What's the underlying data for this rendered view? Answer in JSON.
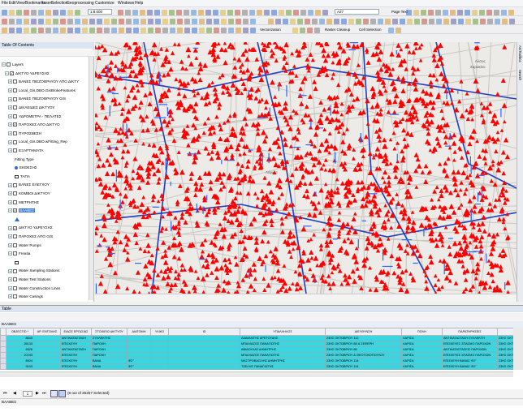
{
  "menu": [
    "File",
    "Edit",
    "View",
    "Bookmarks",
    "Insert",
    "Selection",
    "Geoprocessing",
    "Customize",
    "Windows",
    "Help"
  ],
  "toolbar": {
    "scale": "1:8.000",
    "combo2": "A27",
    "page_text": "Page Text",
    "vectorization": "Vectorization",
    "raster_cleanup": "Raster Cleanup",
    "cell_selection": "Cell Selection"
  },
  "toc": {
    "title": "Table Of Contents",
    "layers": [
      {
        "label": "Layers",
        "indent": 0,
        "expand": "−",
        "check": false,
        "icon": "group"
      },
      {
        "label": "ΔΙΚΤΥΟ ΥΔΡΕΥΣΗΣ",
        "indent": 1,
        "expand": "−",
        "check": true
      },
      {
        "label": "ΒΑΝΕΣ ΠΙΕΖΟΘΡΑΥΟΥ ΑΠΟ ΔΙΚΤΥ",
        "indent": 2,
        "expand": "+",
        "check": false
      },
      {
        "label": "Local_Gis.DBO.GisBrokeFeatures",
        "indent": 2,
        "expand": "+",
        "check": false
      },
      {
        "label": "ΒΑΝΕΣ ΠΙΕΖΟΘΡΑΥΟΥ GIS",
        "indent": 2,
        "expand": "+",
        "check": false
      },
      {
        "label": "ΔΙΚΛΕΙΔΕΣ ΔΙΚΤΥΟΥ",
        "indent": 2,
        "expand": "+",
        "check": false
      },
      {
        "label": "ΥΔΡΟΜΕΤΡΑ - ΠΕΛΑΤΕΣ",
        "indent": 2,
        "expand": "+",
        "check": false
      },
      {
        "label": "ΠΑΡΟΧΕΣ ΑΠΟ ΔΙΚΤΥΟ",
        "indent": 2,
        "expand": "+",
        "check": true
      },
      {
        "label": "ΠΥΡΟΣΒΕΣΗ",
        "indent": 2,
        "expand": "+",
        "check": false
      },
      {
        "label": "Local_Gis.DBO.wFitting_Rep",
        "indent": 2,
        "expand": "+",
        "check": false
      },
      {
        "label": "ΕΞΑΡΤΗΜΑΤΑ",
        "indent": 2,
        "expand": "−",
        "check": false
      },
      {
        "label": "Fitting Type",
        "indent": 4,
        "expand": "",
        "check": false,
        "plain": true
      },
      {
        "label": "ΕΚΘΕΣΗΣ",
        "indent": 4,
        "expand": "",
        "check": false,
        "plain": true,
        "sym": "dot"
      },
      {
        "label": "ΤΑΠΑ",
        "indent": 4,
        "expand": "",
        "check": false,
        "plain": true,
        "sym": "sq"
      },
      {
        "label": "ΒΑΝΕΣ ΕΛΕΓΧΟΥ",
        "indent": 2,
        "expand": "+",
        "check": false
      },
      {
        "label": "ΚΟΜΒΟΙ ΔΙΚΤΥΟΥ",
        "indent": 2,
        "expand": "+",
        "check": false
      },
      {
        "label": "ΜΕΤΡΗΤΗΣ",
        "indent": 2,
        "expand": "+",
        "check": false
      },
      {
        "label": "ΒΛΑΒΕΣ",
        "indent": 2,
        "expand": "−",
        "check": true,
        "selected": true
      },
      {
        "label": "",
        "indent": 4,
        "expand": "",
        "check": false,
        "plain": true,
        "sym": "tri"
      },
      {
        "label": "ΔΙΚΤΥΟ ΥΔΡΕΥΣΗΣ",
        "indent": 2,
        "expand": "+",
        "check": true
      },
      {
        "label": "ΠΑΡΟΧΕΣ ΑΠΟ GIS",
        "indent": 2,
        "expand": "+",
        "check": false
      },
      {
        "label": "Water Pumps",
        "indent": 2,
        "expand": "+",
        "check": false
      },
      {
        "label": "Freatia",
        "indent": 2,
        "expand": "−",
        "check": false
      },
      {
        "label": "",
        "indent": 4,
        "expand": "",
        "check": false,
        "plain": true,
        "sym": "sq"
      },
      {
        "label": "Water Sampling Stations",
        "indent": 2,
        "expand": "+",
        "check": false
      },
      {
        "label": "Water Test Stations",
        "indent": 2,
        "expand": "+",
        "check": false
      },
      {
        "label": "Water Construction Lines",
        "indent": 2,
        "expand": "+",
        "check": false
      },
      {
        "label": "Water Casings",
        "indent": 2,
        "expand": "+",
        "check": false
      },
      {
        "label": "Water Abandoned Lines",
        "indent": 2,
        "expand": "+",
        "check": false
      }
    ]
  },
  "map": {
    "place_label": "Λάρισα",
    "corner_label_1": "Άλσος",
    "corner_label_2": "Σαρακίνο"
  },
  "right_dock": [
    "ArcToolbox",
    "Search"
  ],
  "table": {
    "title": "Table",
    "tab_name": "ΒΛΑΒΕΣ",
    "columns": [
      "OBJECTID *",
      "ΑΡ. ΕΝΤΟΛΗΣ",
      "ΕΙΔΟΣ ΕΡΓΑΣΙΑΣ",
      "ΣΤΟΙΧΕΙΟ ΔΙΚΤΥΟΥ",
      "ΔΙΑΤΟΜΗ",
      "ΥΛΙΚΟ",
      "ID",
      "ΥΠΑΛΛΗΛΟΣ",
      "ΔΙΕΥΘΥΝΣΗ",
      "ΠΟΛΗ",
      "ΠΑΡΑΤΗΡΗΣΕΙΣ",
      ""
    ],
    "rows": [
      [
        "8643",
        "ΑΝΤΙΚΑΤΑΣΤΑΣΗ",
        "ΣΥΛΛΕΚΤΗΣ",
        "",
        "",
        "",
        "ΔΙΑΜΑΝΤΗΣ ΑΡΕΤΟΥΔΗΣ",
        "23ΗΣ ΟΚΤΩΒΡΙΟΥ 112",
        "ΛΑΡΙΣΑ",
        "ΑΝΤΙΚΑΤΑΣΤΑΣΗ ΣΥΛΛΕΚΤΗ",
        "23ΗΣ ΟΚΤΩΒΡΙ"
      ],
      [
        "26133",
        "ΕΠΙΣΚΕΥΗ",
        "ΠΑΡΟΧΗ",
        "",
        "",
        "",
        "ΜΠΑΛΙΑΖΟΣ ΠΑΝΑΓΙΩΤΗΣ",
        "23ΗΣ ΟΚΤΩΒΡΙΟΥ 88 & ΣΕΦΕΡΗ",
        "ΛΑΡΙΣΑ",
        "ΕΠΙΣΚΕΥΕΣ ΣΠΑΣΜΟ ΠΑΡΟΧΩΝ",
        "23ΗΣ ΟΚΤΩΒΡΙ"
      ],
      [
        "6526",
        "ΑΝΤΙΚΑΤΑΣΤΑΣΗ",
        "ΠΑΡΟΧΗ",
        "",
        "",
        "",
        "ΑΒΙΔΟΥΛΑΣ ΔΗΜΗΤΡΗΣ",
        "23ΗΣ ΟΚΤΩΒΡΙΟΥ 86",
        "ΛΑΡΙΣΑ",
        "ΑΝΤΙΚΑΤΑΣΤΑΣΕΙΣ ΠΑΡΟΧΩΝ",
        "23ΗΣ ΟΚΤΩΒΡΙ"
      ],
      [
        "20243",
        "ΕΠΙΣΚΕΥΗ",
        "ΠΑΡΟΧΗ",
        "",
        "",
        "",
        "ΜΠΑΛΙΑΖΟΣ ΠΑΝΑΓΙΩΤΗΣ",
        "23ΗΣ ΟΚΤΩΒΡΙΟΥ & ΘΕΟΤΟΚΟΠΟΥΛΟΥ",
        "ΛΑΡΙΣΑ",
        "ΕΠΙΣΚΕΥΕΣ ΣΠΑΣΜΟ ΠΑΡΟΧΩΝ",
        "23ΗΣ ΟΚΤΩΒΡΙ"
      ],
      [
        "8924",
        "ΕΠΙΣΚΕΥΗ",
        "ΒΑΝΑ",
        "Φ2\"",
        "",
        "",
        "ΜΑΣΤΡΟΒΑΣΙΛΗΣ ΔΗΜΗΤΡΗΣ",
        "23ΗΣ ΟΚΤΩΒΡΙΟΥ 114",
        "ΛΑΡΙΣΑ",
        "ΕΠΙΣΚΕΥΗ ΒΑΝΑΣ Φ2\"",
        "23ΗΣ ΟΚΤΩΒΡΙ"
      ],
      [
        "9103",
        "ΕΠΙΣΚΕΥΗ",
        "ΒΑΝΑ",
        "Φ2\"",
        "",
        "",
        "ΤΖΕΛΗΣ ΠΑΝΑΓΙΩΤΗΣ",
        "23ΗΣ ΟΚΤΩΒΡΙΟΥ 114",
        "ΛΑΡΙΣΑ",
        "ΕΠΙΣΚΕΥΗ ΒΑΝΑΣ Φ2\"",
        "23ΗΣ ΟΚΤΩΒΡΙ"
      ]
    ],
    "nav_position": "1",
    "selected_info": "(8 out of 26257 Selected)",
    "bottom_tab": "ΒΛΑΒΕΣ"
  },
  "colors": {
    "accent": "#2b6cd6",
    "selection": "#39d5e0",
    "defect": "#ff0000",
    "main_pipe": "#1f3fbf",
    "thin_pipe": "#2c66ff"
  }
}
